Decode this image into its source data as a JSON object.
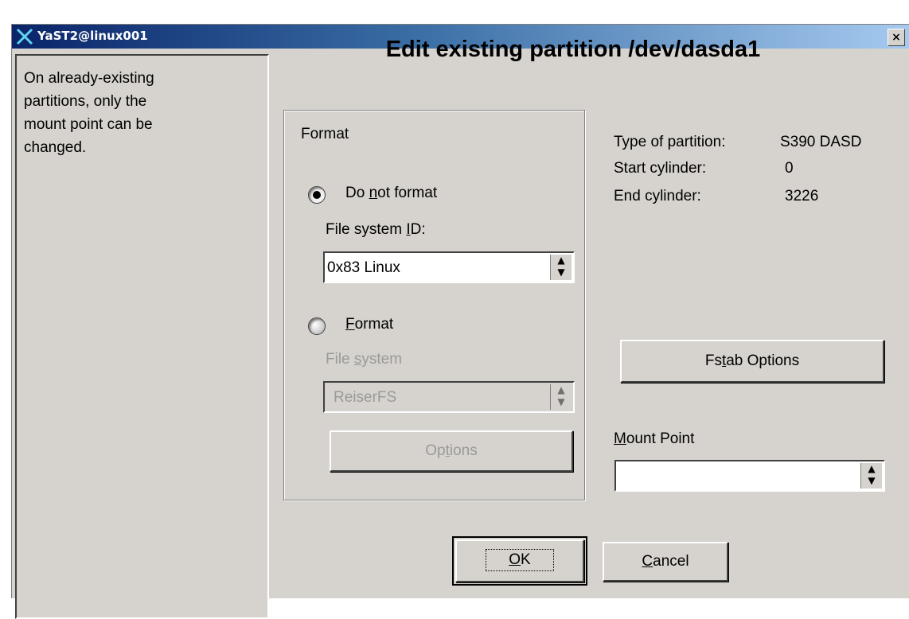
{
  "window": {
    "title": "YaST2@linux001",
    "close_label": "×"
  },
  "help": {
    "lines": [
      "On already-existing",
      "partitions, only the",
      "mount point can be",
      "changed."
    ]
  },
  "heading": "Edit existing partition /dev/dasda1",
  "format": {
    "legend": "Format",
    "do_not_format_label_pre": "Do ",
    "do_not_format_label_u": "n",
    "do_not_format_label_post": "ot format",
    "do_not_format_selected": true,
    "fsid_label_pre": "File system ",
    "fsid_label_u": "I",
    "fsid_label_post": "D:",
    "fsid_value": "0x83 Linux",
    "format_label_u": "F",
    "format_label_post": "ormat",
    "format_selected": false,
    "fs_label_pre": "File ",
    "fs_label_u": "s",
    "fs_label_post": "ystem",
    "fs_value": "ReiserFS",
    "options_pre": "Op",
    "options_u": "t",
    "options_post": "ions"
  },
  "partition_info": {
    "type_label": "Type of partition:",
    "type_value": "S390 DASD",
    "start_label": "Start cylinder:",
    "start_value": "0",
    "end_label": "End cylinder:",
    "end_value": "3226"
  },
  "fstab": {
    "pre": "Fs",
    "u": "t",
    "post": "ab Options"
  },
  "mount": {
    "label_u": "M",
    "label_post": "ount Point",
    "value": ""
  },
  "buttons": {
    "ok_u": "O",
    "ok_post": "K",
    "cancel_u": "C",
    "cancel_post": "ancel"
  },
  "icons": {
    "combo_arrow": "up-down-arrows-icon",
    "logo": "yast-logo-icon"
  }
}
